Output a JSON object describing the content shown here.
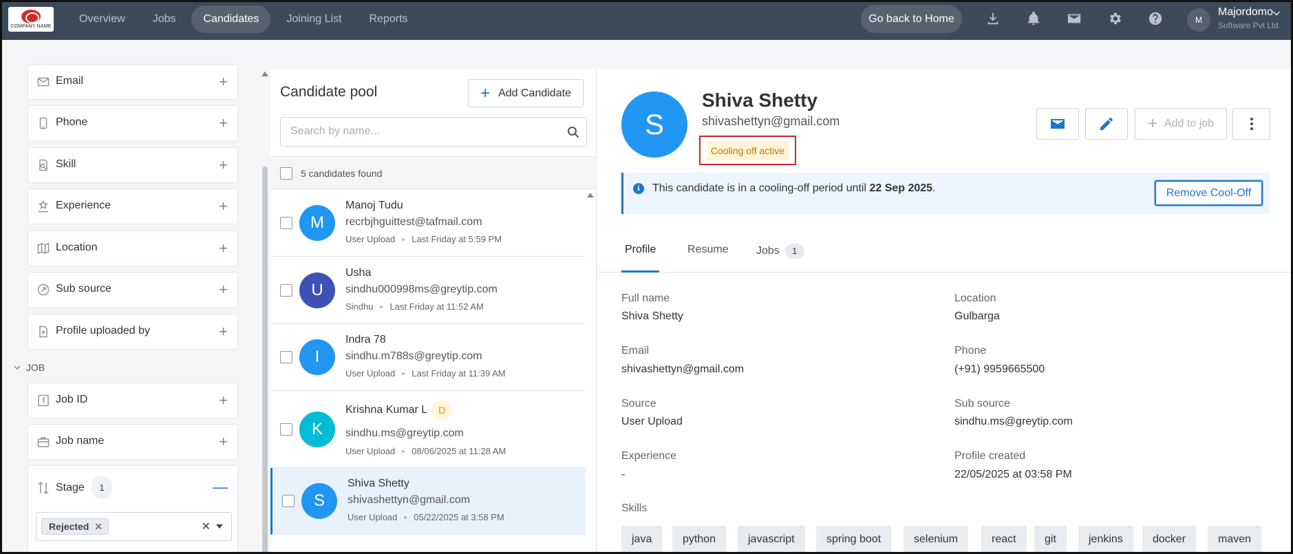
{
  "logo": {
    "text": "COMPANY NAME"
  },
  "nav": {
    "items": [
      "Overview",
      "Jobs",
      "Candidates",
      "Joining List",
      "Reports"
    ],
    "active": "Candidates",
    "home_button": "Go back to Home"
  },
  "user": {
    "initial": "M",
    "name": "Majordomo",
    "org": "Software Pvt Ltd"
  },
  "filters": {
    "items": [
      {
        "label": "Email",
        "icon": "mail-icon"
      },
      {
        "label": "Phone",
        "icon": "phone-icon"
      },
      {
        "label": "Skill",
        "icon": "skill-icon"
      },
      {
        "label": "Experience",
        "icon": "experience-icon"
      },
      {
        "label": "Location",
        "icon": "map-icon"
      },
      {
        "label": "Sub source",
        "icon": "subsource-icon"
      },
      {
        "label": "Profile uploaded by",
        "icon": "upload-file-icon"
      }
    ],
    "section": "JOB",
    "job_items": [
      {
        "label": "Job ID",
        "icon": "job-id-icon"
      },
      {
        "label": "Job name",
        "icon": "briefcase-icon"
      }
    ],
    "stage": {
      "label": "Stage",
      "count": "1",
      "chip": "Rejected"
    }
  },
  "pool": {
    "title": "Candidate pool",
    "add_button": "Add Candidate",
    "search_placeholder": "Search by name...",
    "found": "5 candidates found",
    "candidates": [
      {
        "initial": "M",
        "name": "Manoj Tudu",
        "email": "recrbjhguittest@tafmail.com",
        "source": "User Upload",
        "time": "Last Friday at 5:59 PM",
        "color": "#2196f3",
        "badge": ""
      },
      {
        "initial": "U",
        "name": "Usha",
        "email": "sindhu000998ms@greytip.com",
        "source": "Sindhu",
        "time": "Last Friday at 11:52 AM",
        "color": "#3f51b5",
        "badge": ""
      },
      {
        "initial": "I",
        "name": "Indra 78",
        "email": "sindhu.m788s@greytip.com",
        "source": "User Upload",
        "time": "Last Friday at 11:39 AM",
        "color": "#2196f3",
        "badge": ""
      },
      {
        "initial": "K",
        "name": "Krishna Kumar L",
        "email": "sindhu.ms@greytip.com",
        "source": "User Upload",
        "time": "08/06/2025 at 11:28 AM",
        "color": "#00bcd4",
        "badge": "D"
      },
      {
        "initial": "S",
        "name": "Shiva Shetty",
        "email": "shivashettyn@gmail.com",
        "source": "User Upload",
        "time": "05/22/2025 at 3:58 PM",
        "color": "#2196f3",
        "badge": ""
      }
    ]
  },
  "detail": {
    "initial": "S",
    "name": "Shiva Shetty",
    "email": "shivashettyn@gmail.com",
    "status": "Cooling off active",
    "add_to_job": "Add to job",
    "notice": {
      "prefix": "This candidate is in a cooling-off period until ",
      "date": "22 Sep 2025",
      "suffix": ".",
      "button": "Remove Cool-Off"
    },
    "tabs": [
      {
        "label": "Profile"
      },
      {
        "label": "Resume"
      },
      {
        "label": "Jobs",
        "count": "1"
      }
    ],
    "fields": [
      {
        "label": "Full name",
        "value": "Shiva Shetty"
      },
      {
        "label": "Location",
        "value": "Gulbarga"
      },
      {
        "label": "Email",
        "value": "shivashettyn@gmail.com"
      },
      {
        "label": "Phone",
        "value": "(+91) 9959665500"
      },
      {
        "label": "Source",
        "value": "User Upload"
      },
      {
        "label": "Sub source",
        "value": "sindhu.ms@greytip.com"
      },
      {
        "label": "Experience",
        "value": "-"
      },
      {
        "label": "Profile created",
        "value": "22/05/2025 at 03:58 PM"
      }
    ],
    "skills_label": "Skills",
    "skills": [
      "java",
      "python",
      "javascript",
      "spring boot",
      "selenium",
      "react",
      "git",
      "jenkins",
      "docker",
      "maven"
    ]
  },
  "colors": {
    "nav_bg": "#3d4a59",
    "accent": "#1f77c9",
    "warning": "#c77700",
    "alert_border": "#c62828"
  }
}
